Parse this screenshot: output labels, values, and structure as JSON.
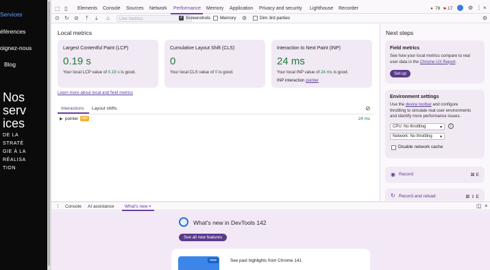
{
  "site": {
    "nav": [
      "Services",
      "éférences",
      "oignez-nous",
      "Blog"
    ],
    "hero_big": [
      "Nos",
      "serv",
      "ices"
    ],
    "hero_small": [
      "DE LA",
      "STRATÉ",
      "GIE À LA",
      "RÉALISA",
      "TION"
    ]
  },
  "devtools": {
    "tabs": [
      "Elements",
      "Console",
      "Sources",
      "Network",
      "Performance",
      "Memory",
      "Application",
      "Privacy and security",
      "Lighthouse",
      "Recorder"
    ],
    "active_tab": "Performance",
    "errors": "78",
    "warnings": "17",
    "toolbar": {
      "live_select": "Live metrics",
      "screenshots_label": "Screenshots",
      "memory_label": "Memory",
      "dim_label": "Dim 3rd parties"
    },
    "local_metrics": {
      "heading": "Local metrics",
      "cards": [
        {
          "title": "Largest Contentful Paint (LCP)",
          "value": "0.19 s",
          "desc_pre": "Your local LCP value of ",
          "desc_value": "0.19 s",
          "desc_post": " is good."
        },
        {
          "title": "Cumulative Layout Shift (CLS)",
          "value": "0",
          "desc_pre": "Your local CLS value of ",
          "desc_value": "0",
          "desc_post": " is good."
        },
        {
          "title": "Interaction to Next Paint (INP)",
          "value": "24 ms",
          "desc_pre": "Your local INP value of ",
          "desc_value": "24 ms",
          "desc_post": " is good.",
          "extra_label": "INP interaction ",
          "extra_link": "pointer"
        }
      ],
      "learn_more": "Learn more about local and field metrics",
      "subtabs": [
        "Interactions",
        "Layout shifts"
      ],
      "interaction": {
        "name": "pointer",
        "badge": "INP",
        "time": "24 ms"
      }
    },
    "next_steps": {
      "heading": "Next steps",
      "field": {
        "title": "Field metrics",
        "text1": "See how your local metrics compare to real",
        "text2_pre": "user data in the ",
        "text2_link": "Chrome UX Report",
        "text2_post": ".",
        "button": "Set up"
      },
      "env": {
        "title": "Environment settings",
        "text1_pre": "Use the ",
        "text1_link": "device toolbar",
        "text1_post": " and configure",
        "text2": "throttling to simulate real user environments",
        "text3": "and identify more performance issues.",
        "cpu": "CPU: No throttling",
        "network": "Network: No throttling",
        "disable_cache": "Disable network cache"
      },
      "record": {
        "label": "Record",
        "shortcut": "⌘ E"
      },
      "record_reload": {
        "label": "Record and reload",
        "shortcut": "⌘ ⇧ E"
      }
    },
    "drawer": {
      "tabs": [
        "Console",
        "AI assistance",
        "What's new"
      ],
      "active_tab": "What's new",
      "title": "What's new in DevTools 142",
      "see_all": "See all new features",
      "badge": "new",
      "past_highlights": "See past highlights from Chrome 141"
    }
  }
}
